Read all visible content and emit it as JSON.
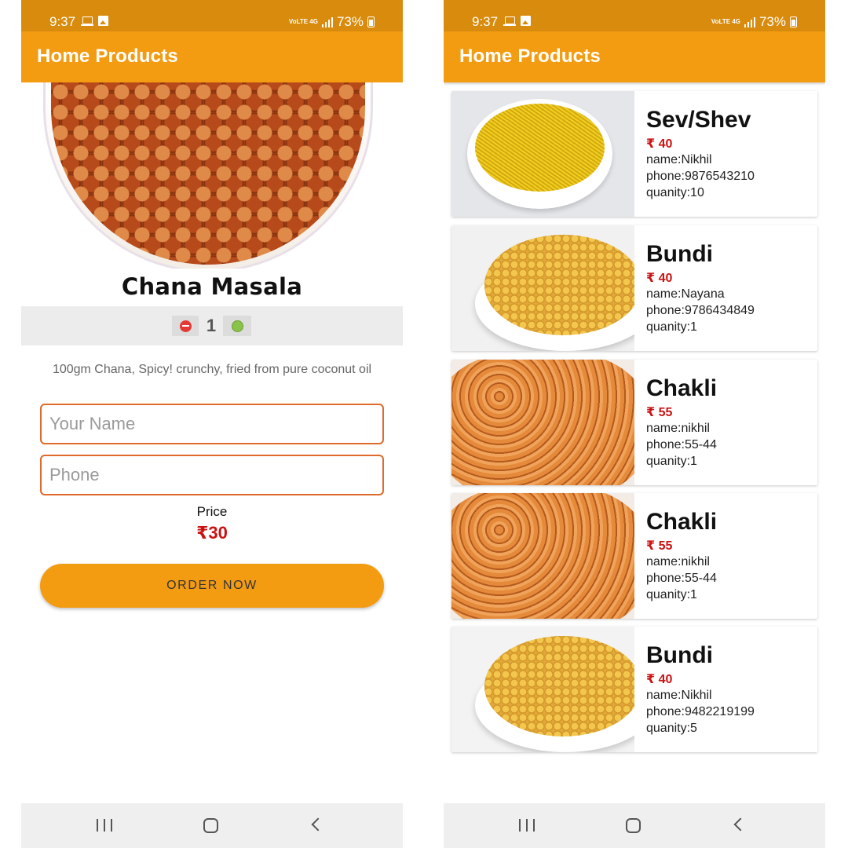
{
  "status": {
    "time": "9:37",
    "network": "VoLTE 4G",
    "battery": "73%"
  },
  "detail": {
    "app_title": "Home Products",
    "product_name": "Chana Masala",
    "quantity": "1",
    "description": "100gm Chana, Spicy! crunchy, fried from pure coconut oil",
    "name_placeholder": "Your Name",
    "phone_placeholder": "Phone",
    "price_label": "Price",
    "price_value": "₹30",
    "order_button": "ORDER NOW"
  },
  "list": {
    "app_title": "Home Products",
    "items": [
      {
        "title": "Sev/Shev",
        "price": "₹ 40",
        "name": "name:Nikhil",
        "phone": "phone:9876543210",
        "quantity": "quanity:10",
        "image": "sev"
      },
      {
        "title": "Bundi",
        "price": "₹ 40",
        "name": "name:Nayana",
        "phone": "phone:9786434849",
        "quantity": "quanity:1",
        "image": "bundi"
      },
      {
        "title": "Chakli",
        "price": "₹ 55",
        "name": "name:nikhil",
        "phone": "phone:55-44",
        "quantity": "quanity:1",
        "image": "chakli"
      },
      {
        "title": "Chakli",
        "price": "₹ 55",
        "name": "name:nikhil",
        "phone": "phone:55-44",
        "quantity": "quanity:1",
        "image": "chakli"
      },
      {
        "title": "Bundi",
        "price": "₹ 40",
        "name": "name:Nikhil",
        "phone": "phone:9482219199",
        "quantity": "quanity:5",
        "image": "bundi"
      }
    ]
  },
  "icons": {
    "status": [
      "laptop-icon",
      "image-icon",
      "signal-icon",
      "battery-icon"
    ],
    "quantity": [
      "minus-icon",
      "plus-icon"
    ],
    "nav": [
      "recent-apps-icon",
      "home-icon",
      "back-icon"
    ]
  },
  "colors": {
    "status_bar": "#d88b0c",
    "app_bar": "#f39c12",
    "accent_border": "#e0692c",
    "price_red": "#cc1111",
    "minus_red": "#e53935",
    "plus_green": "#8bc34a"
  }
}
